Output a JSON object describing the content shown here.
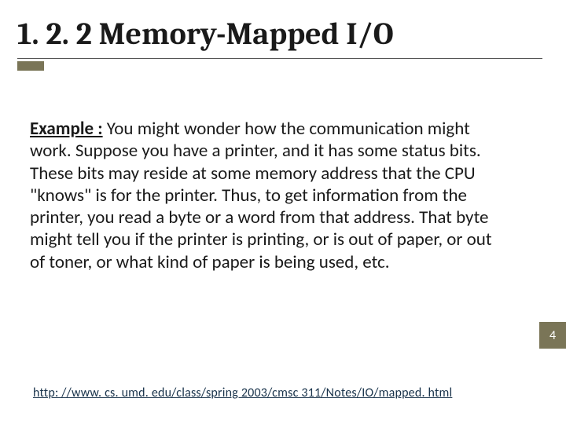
{
  "slide": {
    "title": "1. 2. 2 Memory-Mapped I/O",
    "example_label": "Example :",
    "body_text": " You might wonder how the communication might work. Suppose you have a printer, and it has some status bits. These bits may reside at some memory address that the CPU \"knows\" is for the printer. Thus, to get information from the printer, you read a byte or a word from that address. That byte might tell you if the printer is printing, or is out of paper, or out of toner, or what kind of paper is being used, etc.",
    "link": "http: //www. cs. umd. edu/class/spring 2003/cmsc 311/Notes/IO/mapped. html",
    "page_number": "4"
  },
  "colors": {
    "accent": "#7a7557"
  }
}
